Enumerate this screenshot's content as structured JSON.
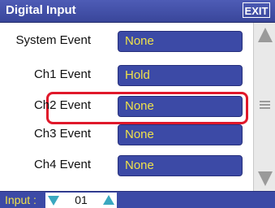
{
  "window": {
    "title": "Digital Input",
    "exit_label": "EXIT"
  },
  "rows": [
    {
      "label": "System Event",
      "value": "None"
    },
    {
      "label": "Ch1 Event",
      "value": "Hold"
    },
    {
      "label": "Ch2 Event",
      "value": "None"
    },
    {
      "label": "Ch3 Event",
      "value": "None"
    },
    {
      "label": "Ch4 Event",
      "value": "None"
    }
  ],
  "footer": {
    "input_label": "Input :",
    "input_value": "01"
  },
  "icons": {
    "scroll_up": "triangle-up-icon",
    "scroll_down": "triangle-down-icon",
    "scroll_thumb": "grip-lines-icon",
    "decrement": "triangle-down-icon",
    "increment": "triangle-up-icon"
  },
  "colors": {
    "title_bar": "#3f4ca8",
    "value_field": "#3c4aa6",
    "value_text": "#f0e24a",
    "highlight": "#e0182a",
    "arrow_icon": "#3aa8c0"
  }
}
